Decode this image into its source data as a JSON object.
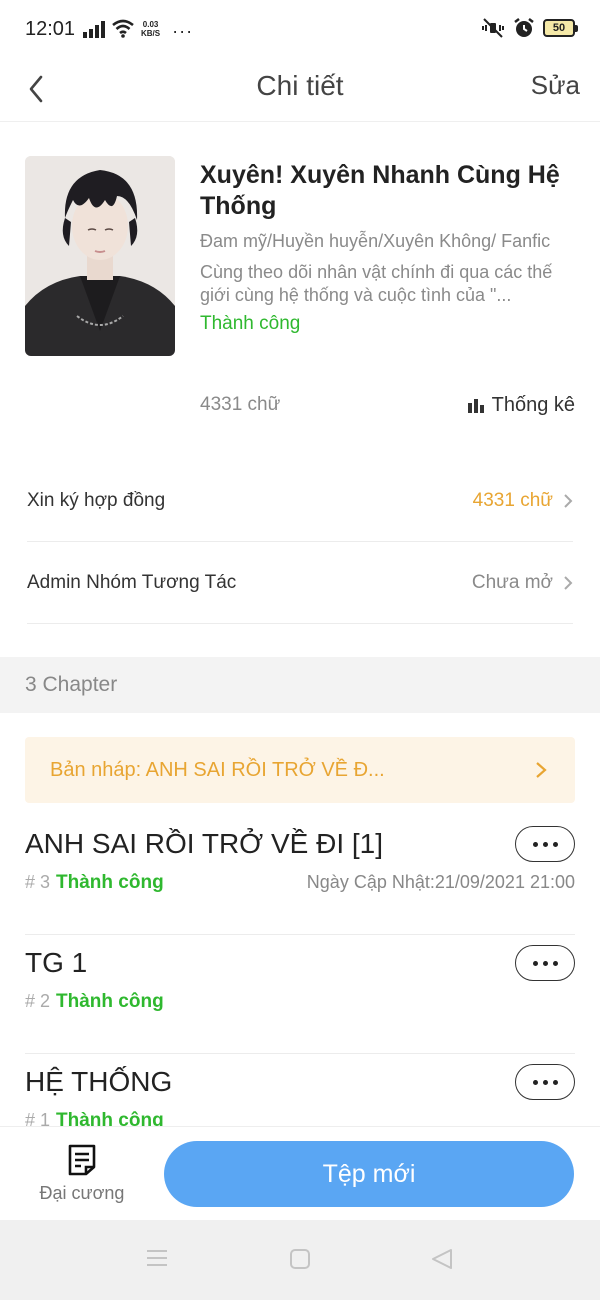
{
  "status_bar": {
    "time": "12:01",
    "net_speed_value": "0.03",
    "net_speed_unit": "KB/S",
    "more": "···",
    "battery": "50"
  },
  "nav": {
    "title": "Chi tiết",
    "edit_label": "Sửa"
  },
  "book": {
    "title": "Xuyên! Xuyên Nhanh Cùng Hệ Thống",
    "genres": "Đam mỹ/Huyền huyễn/Xuyên Không/ Fanfic",
    "description": "Cùng theo dõi nhân vật chính đi qua các thế giới cùng hệ thống và cuộc tình của \"...",
    "status": "Thành công",
    "word_count": "4331 chữ",
    "stats_label": "Thống kê"
  },
  "rows": [
    {
      "label": "Xin ký hợp đồng",
      "value": "4331 chữ",
      "value_color": "#e8a532"
    },
    {
      "label": "Admin Nhóm Tương Tác",
      "value": "Chưa mở",
      "value_color": "#8a8a8a"
    }
  ],
  "chapters_header": "3 Chapter",
  "draft": {
    "label": "Bản nháp: ANH SAI RỒI TRỞ VỀ Đ..."
  },
  "chapters": [
    {
      "title": "ANH SAI RỒI TRỞ VỀ ĐI [1]",
      "number": "# 3",
      "status": "Thành công",
      "updated": "Ngày Cập Nhật:21/09/2021 21:00"
    },
    {
      "title": "TG 1",
      "number": "# 2",
      "status": "Thành công",
      "updated": ""
    },
    {
      "title": "HỆ THỐNG",
      "number": "# 1",
      "status": "Thành công",
      "updated": ""
    }
  ],
  "bottom": {
    "outline_label": "Đại cương",
    "new_file_label": "Tệp mới"
  },
  "colors": {
    "success": "#2fb82f",
    "accent_orange": "#e8a532",
    "primary_blue": "#5aa6f3"
  },
  "icons": [
    "signal-icon",
    "wifi-icon",
    "mute-icon",
    "alarm-icon",
    "battery-icon",
    "back-chevron-icon",
    "bar-chart-icon",
    "chevron-right-icon",
    "more-dots-icon",
    "document-list-icon",
    "menu-icon",
    "home-square-icon",
    "back-triangle-icon"
  ]
}
